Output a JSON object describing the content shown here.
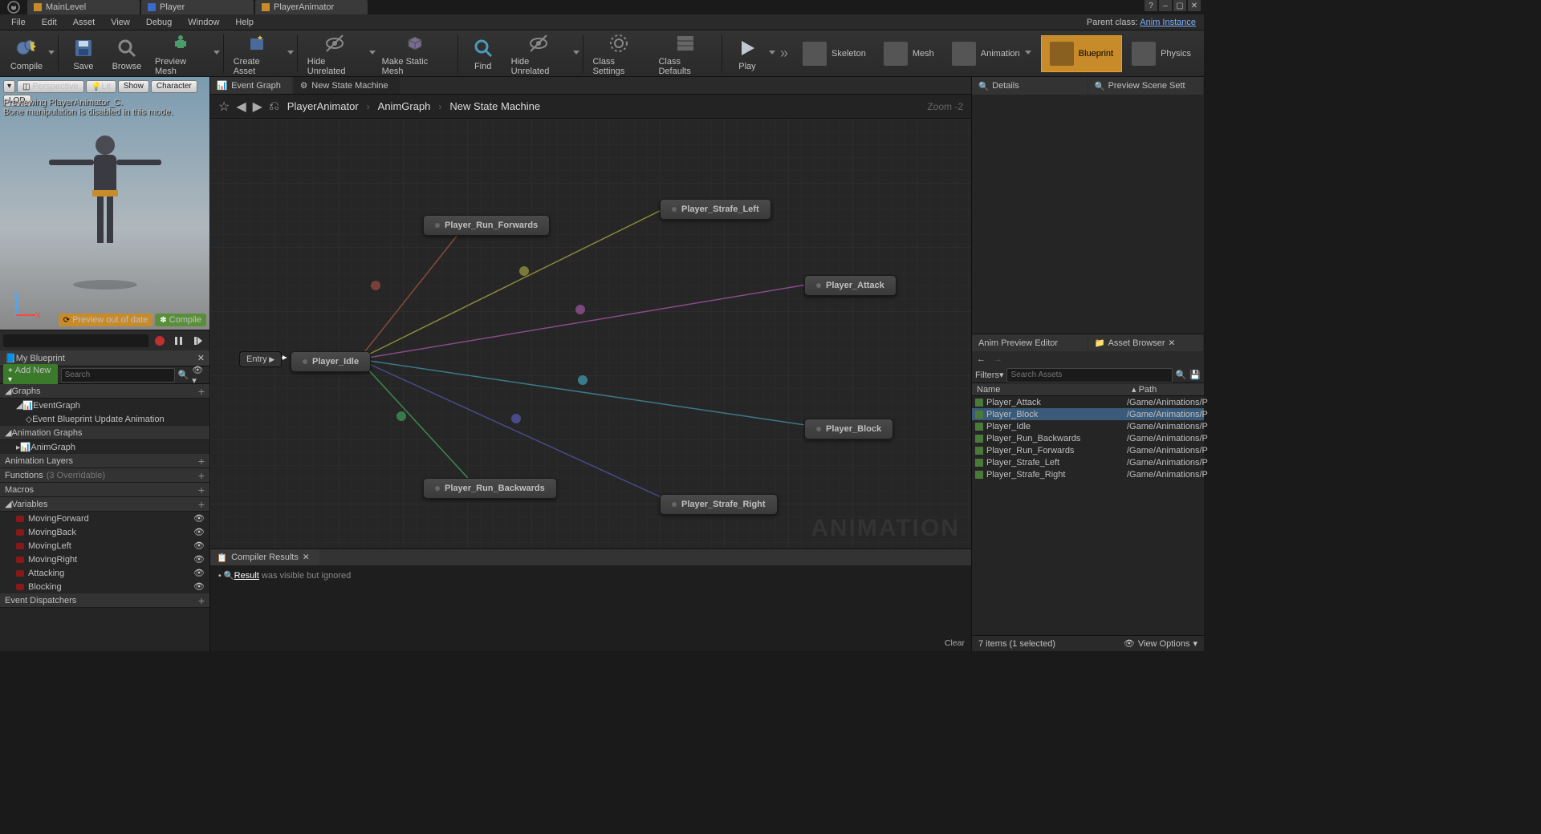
{
  "top_tabs": [
    "MainLevel",
    "Player",
    "PlayerAnimator"
  ],
  "menu": [
    "File",
    "Edit",
    "Asset",
    "View",
    "Debug",
    "Window",
    "Help"
  ],
  "parent_class_label": "Parent class:",
  "parent_class_link": "Anim Instance",
  "toolbar": {
    "compile": "Compile",
    "save": "Save",
    "browse": "Browse",
    "preview_mesh": "Preview Mesh",
    "create_asset": "Create Asset",
    "hide_unrelated": "Hide Unrelated",
    "make_static": "Make Static Mesh",
    "find": "Find",
    "hide_unrelated2": "Hide Unrelated",
    "class_settings": "Class Settings",
    "class_defaults": "Class Defaults",
    "play": "Play"
  },
  "modes": {
    "skeleton": "Skeleton",
    "mesh": "Mesh",
    "animation": "Animation",
    "blueprint": "Blueprint",
    "physics": "Physics"
  },
  "viewport": {
    "buttons": [
      "Perspective",
      "Lit",
      "Show",
      "Character",
      "LOD"
    ],
    "overlay_l1": "Previewing PlayerAnimator_C.",
    "overlay_l2": "Bone manipulation is disabled in this mode.",
    "preview_out": "Preview out of date",
    "compile": "Compile"
  },
  "mybp": {
    "title": "My Blueprint",
    "add": "Add New",
    "search_ph": "Search"
  },
  "sections": {
    "graphs": "Graphs",
    "eventgraph": "EventGraph",
    "event_bp": "Event Blueprint Update Animation",
    "animgraphs": "Animation Graphs",
    "animgraph": "AnimGraph",
    "animlayers": "Animation Layers",
    "functions": "Functions",
    "functions_suffix": "(3 Overridable)",
    "macros": "Macros",
    "variables": "Variables",
    "vars": [
      "MovingForward",
      "MovingBack",
      "MovingLeft",
      "MovingRight",
      "Attacking",
      "Blocking"
    ],
    "dispatchers": "Event Dispatchers"
  },
  "center_tabs": {
    "event": "Event Graph",
    "nsm": "New State Machine"
  },
  "breadcrumb": {
    "a": "PlayerAnimator",
    "b": "AnimGraph",
    "c": "New State Machine",
    "zoom": "Zoom  -2"
  },
  "entry": "Entry",
  "nodes": {
    "idle": "Player_Idle",
    "run_fwd": "Player_Run_Forwards",
    "run_bwd": "Player_Run_Backwards",
    "strafe_l": "Player_Strafe_Left",
    "strafe_r": "Player_Strafe_Right",
    "attack": "Player_Attack",
    "block": "Player_Block"
  },
  "watermark": "ANIMATION",
  "compiler": {
    "title": "Compiler Results",
    "result_label": "Result",
    "msg": " was visible but ignored",
    "clear": "Clear"
  },
  "right": {
    "details": "Details",
    "preview_scene": "Preview Scene Sett",
    "anim_prev": "Anim Preview Editor",
    "asset_browser": "Asset Browser",
    "filters": "Filters",
    "search_ph": "Search Assets",
    "col_name": "Name",
    "col_path": "Path",
    "assets": [
      {
        "n": "Player_Attack",
        "p": "/Game/Animations/P"
      },
      {
        "n": "Player_Block",
        "p": "/Game/Animations/P"
      },
      {
        "n": "Player_Idle",
        "p": "/Game/Animations/P"
      },
      {
        "n": "Player_Run_Backwards",
        "p": "/Game/Animations/P"
      },
      {
        "n": "Player_Run_Forwards",
        "p": "/Game/Animations/P"
      },
      {
        "n": "Player_Strafe_Left",
        "p": "/Game/Animations/P"
      },
      {
        "n": "Player_Strafe_Right",
        "p": "/Game/Animations/P"
      }
    ],
    "status": "7 items (1 selected)",
    "view_options": "View Options"
  }
}
